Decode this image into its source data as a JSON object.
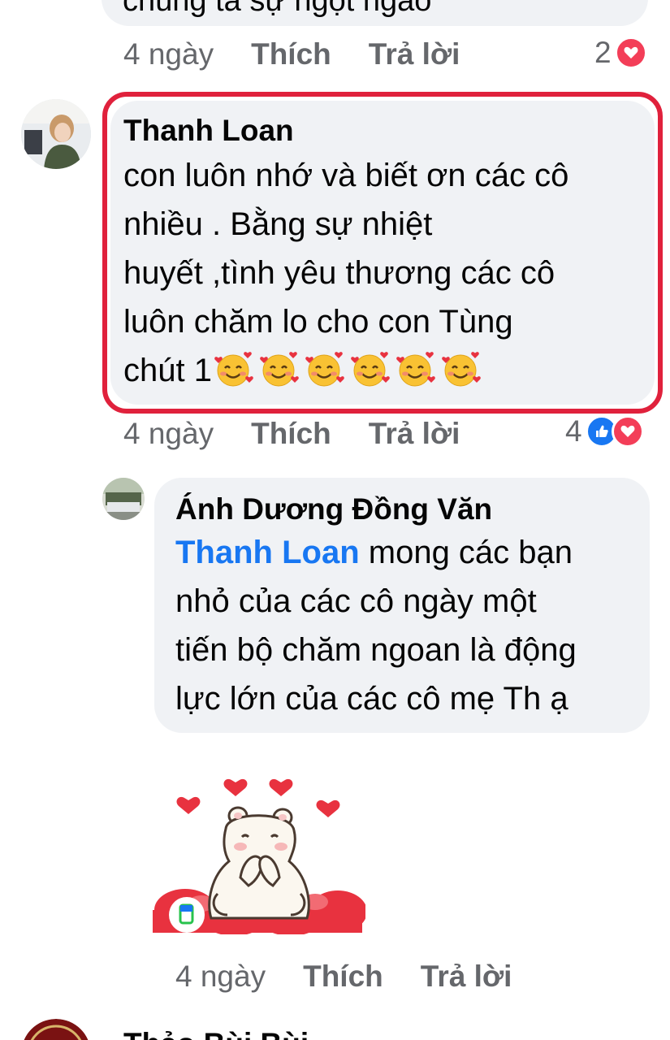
{
  "top_comment": {
    "text": "chúng ta sự ngọt ngào",
    "time": "4 ngày",
    "like_label": "Thích",
    "reply_label": "Trả lời",
    "reaction_count": "2",
    "reaction_icons": [
      "heart-icon"
    ]
  },
  "comment_main": {
    "author": "Thanh Loan",
    "text_lines": [
      "con luôn nhớ và biết ơn các cô",
      "nhiều . Bằng sự nhiệt",
      "huyết ,tình yêu thương các cô",
      "luôn chăm lo cho con Tùng",
      "chút 1"
    ],
    "emoji_count": 6,
    "time": "4 ngày",
    "like_label": "Thích",
    "reply_label": "Trả lời",
    "reaction_count": "4",
    "reaction_icons": [
      "like-icon",
      "heart-icon"
    ],
    "highlight_color": "#e0213c"
  },
  "reply": {
    "author": "Ánh Dương Đồng Văn",
    "mention": "Thanh Loan",
    "text_lines": [
      " mong các bạn",
      "nhỏ của các cô ngày một",
      "tiến bộ chăm ngoan là động",
      "lực lớn của các cô mẹ Th ạ"
    ],
    "sticker": "bear-hearts-sticker",
    "time": "4 ngày",
    "like_label": "Thích",
    "reply_label": "Trả lời"
  },
  "bottom_comment": {
    "author_partial": "Thảo Bùi Bùi"
  },
  "colors": {
    "bubble_bg": "#f0f2f5",
    "secondary_text": "#65676b",
    "link_blue": "#1877f2",
    "heart_red": "#f33e58"
  }
}
